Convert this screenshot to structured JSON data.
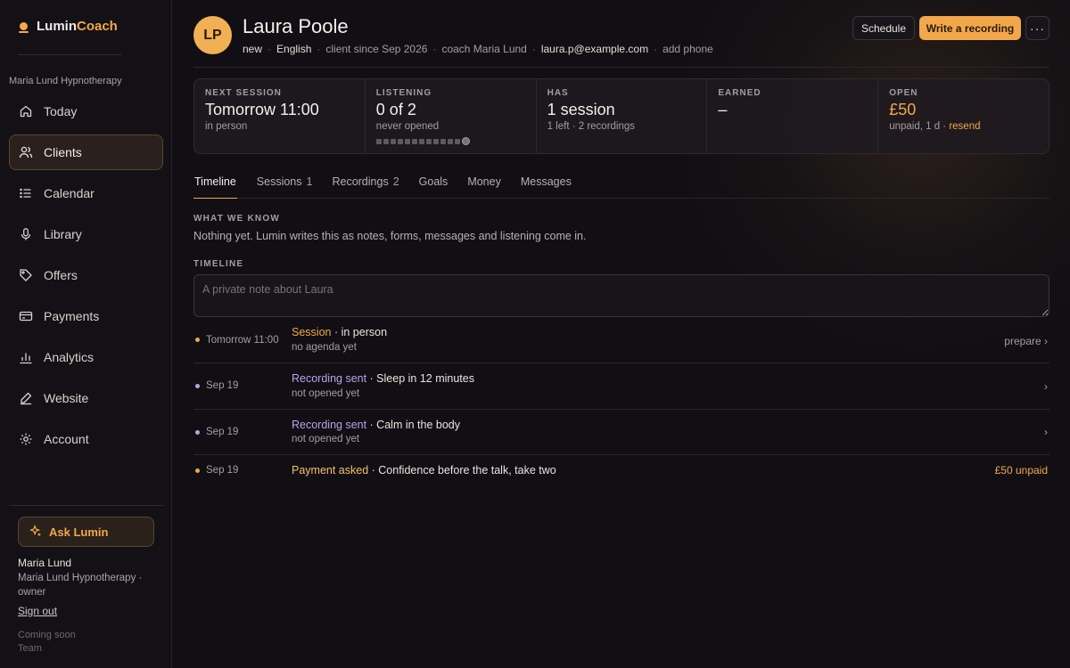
{
  "brand": {
    "part1": "Lumin",
    "part2": "Coach",
    "accent_color": "#f2a84a"
  },
  "sidebar": {
    "workspace": "Maria Lund Hypnotherapy",
    "items": [
      {
        "label": "Today",
        "icon": "home-icon",
        "active": false
      },
      {
        "label": "Clients",
        "icon": "users-icon",
        "active": true
      },
      {
        "label": "Calendar",
        "icon": "list-icon",
        "active": false
      },
      {
        "label": "Library",
        "icon": "microphone-icon",
        "active": false
      },
      {
        "label": "Offers",
        "icon": "tag-icon",
        "active": false
      },
      {
        "label": "Payments",
        "icon": "credit-card-icon",
        "active": false
      },
      {
        "label": "Analytics",
        "icon": "bar-chart-icon",
        "active": false
      },
      {
        "label": "Website",
        "icon": "pen-icon",
        "active": false
      },
      {
        "label": "Account",
        "icon": "gear-icon",
        "active": false
      }
    ],
    "ask_label": "Ask Lumin",
    "user_name": "Maria Lund",
    "user_org": "Maria Lund Hypnotherapy · owner",
    "sign_out": "Sign out",
    "coming_soon": "Coming soon",
    "team": "Team"
  },
  "client": {
    "initials": "LP",
    "name": "Laura Poole",
    "meta": {
      "status": "new",
      "language": "English",
      "since": "client since Sep 2026",
      "coach": "coach Maria Lund",
      "email": "laura.p@example.com",
      "add_phone": "add phone"
    }
  },
  "actions": {
    "schedule": "Schedule",
    "write": "Write a recording",
    "more": "···"
  },
  "stats": {
    "next_session": {
      "label": "NEXT SESSION",
      "value": "Tomorrow 11:00",
      "sub": "in person"
    },
    "listening": {
      "label": "LISTENING",
      "value": "0 of 2",
      "sub": "never opened",
      "progress": 0
    },
    "has": {
      "label": "HAS",
      "value": "1 session",
      "sub": "1 left · 2 recordings"
    },
    "earned": {
      "label": "EARNED",
      "value": "–"
    },
    "open": {
      "label": "OPEN",
      "value": "£50",
      "sub": "unpaid, 1 d · ",
      "link": "resend"
    }
  },
  "tabs": [
    {
      "label": "Timeline",
      "count": "",
      "active": true
    },
    {
      "label": "Sessions",
      "count": "1",
      "active": false
    },
    {
      "label": "Recordings",
      "count": "2",
      "active": false
    },
    {
      "label": "Goals",
      "count": "",
      "active": false
    },
    {
      "label": "Money",
      "count": "",
      "active": false
    },
    {
      "label": "Messages",
      "count": "",
      "active": false
    }
  ],
  "know": {
    "label": "WHAT WE KNOW",
    "text": "Nothing yet. Lumin writes this as notes, forms, messages and listening come in."
  },
  "timeline": {
    "label": "TIMELINE",
    "note_placeholder": "A private note about Laura",
    "rows": [
      {
        "date": "Tomorrow 11:00",
        "kind": "Session",
        "kind_class": "kind-session",
        "text": " · in person",
        "sub": "no agenda yet",
        "right": "prepare ›",
        "dot": "#f2a84a"
      },
      {
        "date": "Sep 19",
        "kind": "Recording sent",
        "kind_class": "kind-recording",
        "text": " · Sleep in 12 minutes",
        "sub": "not opened yet",
        "right": "›",
        "dot": "#b5a6e8"
      },
      {
        "date": "Sep 19",
        "kind": "Recording sent",
        "kind_class": "kind-recording",
        "text": " · Calm in the body",
        "sub": "not opened yet",
        "right": "›",
        "dot": "#b5a6e8"
      },
      {
        "date": "Sep 19",
        "kind": "Payment asked",
        "kind_class": "kind-payment",
        "text": " · Confidence before the talk, take two",
        "sub": "",
        "right": "£50 unpaid",
        "dot": "#f2a84a"
      }
    ]
  }
}
